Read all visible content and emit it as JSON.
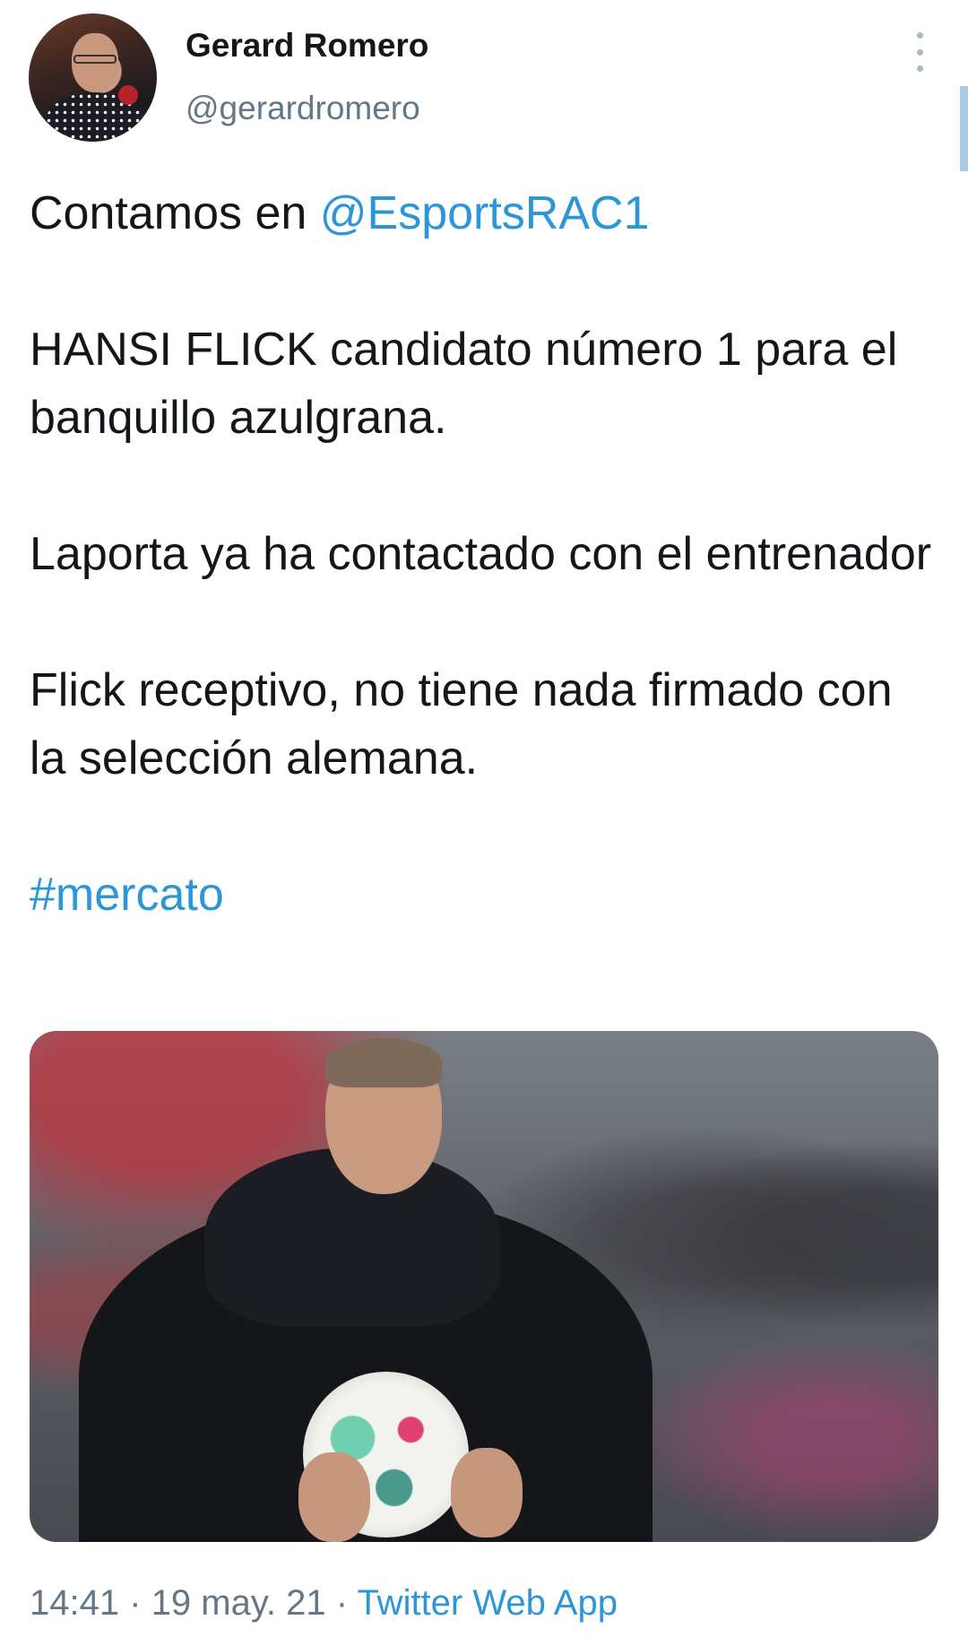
{
  "author": {
    "name": "Gerard Romero",
    "handle": "@gerardromero"
  },
  "menu_icon": "more-vertical-icon",
  "tweet": {
    "line1_prefix": "Contamos en ",
    "mention": "@EsportsRAC1",
    "paragraph2": "HANSI FLICK candidato número 1 para el banquillo azulgrana.",
    "paragraph3": "Laporta ya ha contactado con el entrenador",
    "paragraph4": "Flick receptivo, no tiene nada firmado con la selección alemana.",
    "hashtag": "#mercato"
  },
  "footer": {
    "time": "14:41",
    "separator": "·",
    "date": "19 may. 21",
    "source": "Twitter Web App"
  },
  "colors": {
    "link": "#2c96d8",
    "text": "#14171a",
    "secondary": "#657786"
  }
}
